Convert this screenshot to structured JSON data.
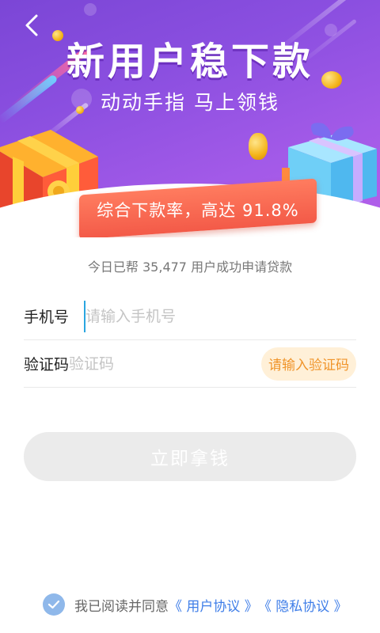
{
  "navigation": {
    "back_icon": "chevron-left-icon"
  },
  "hero": {
    "title": "新用户稳下款",
    "subtitle": "动动手指  马上领钱",
    "rate_banner": "综合下款率，高达 91.8%",
    "colors": {
      "gradient_start": "#7b46d6",
      "gradient_end": "#b560ea",
      "ribbon": "#f35a48"
    }
  },
  "stats_line": "今日已帮 35,477 用户成功申请贷款",
  "form": {
    "phone": {
      "label": "手机号",
      "value": "",
      "placeholder": "请输入手机号"
    },
    "code": {
      "label": "验证码",
      "value": "",
      "placeholder": "验证码",
      "send_button": "请输入验证码"
    },
    "submit": "立即拿钱"
  },
  "agreement": {
    "checked": true,
    "check_icon": "checkmark-circle-icon",
    "text": "我已阅读并同意",
    "user_agreement": "《 用户协议 》",
    "privacy_policy": "《 隐私协议 》",
    "link_color": "#3f7ee8"
  }
}
